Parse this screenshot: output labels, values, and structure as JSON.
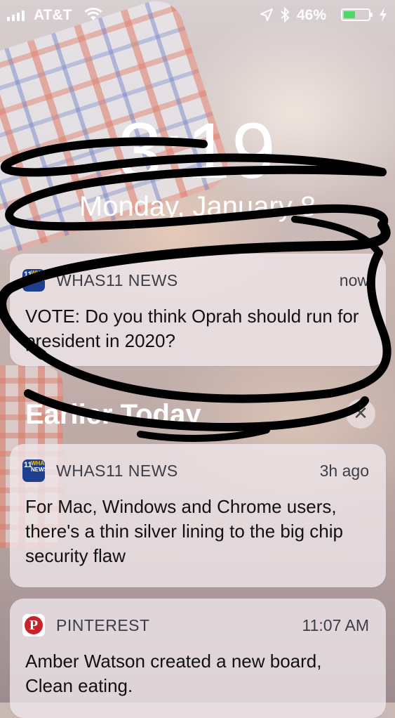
{
  "status_bar": {
    "carrier": "AT&T",
    "battery_percent": "46%",
    "battery_level": 0.46,
    "charging": true
  },
  "lock_screen": {
    "time": "3:19",
    "date": "Monday, January 8"
  },
  "notifications": [
    {
      "app": "WHAS11 NEWS",
      "icon": "whas11-news-icon",
      "time": "now",
      "message": "VOTE: Do you think Oprah should run for president in 2020?"
    }
  ],
  "earlier_section": {
    "title": "Earlier Today",
    "clear_label": "✕",
    "notifications": [
      {
        "app": "WHAS11 NEWS",
        "icon": "whas11-news-icon",
        "time": "3h ago",
        "message": "For Mac, Windows and Chrome users, there's a thin silver lining to the big chip security flaw"
      },
      {
        "app": "PINTEREST",
        "icon": "pinterest-icon",
        "time": "11:07 AM",
        "message": "Amber Watson created a new board, Clean eating."
      }
    ]
  },
  "app_icon_text": {
    "whas_number": "11",
    "whas_top": "WHAS",
    "whas_bottom": "NEWS",
    "pinterest_letter": "P"
  },
  "colors": {
    "battery_fill": "#4cd964",
    "scribble": "#000000",
    "notification_bg": "#f0e8ec",
    "pinterest_red": "#c8232c",
    "whas_blue": "#1d3f8e"
  }
}
